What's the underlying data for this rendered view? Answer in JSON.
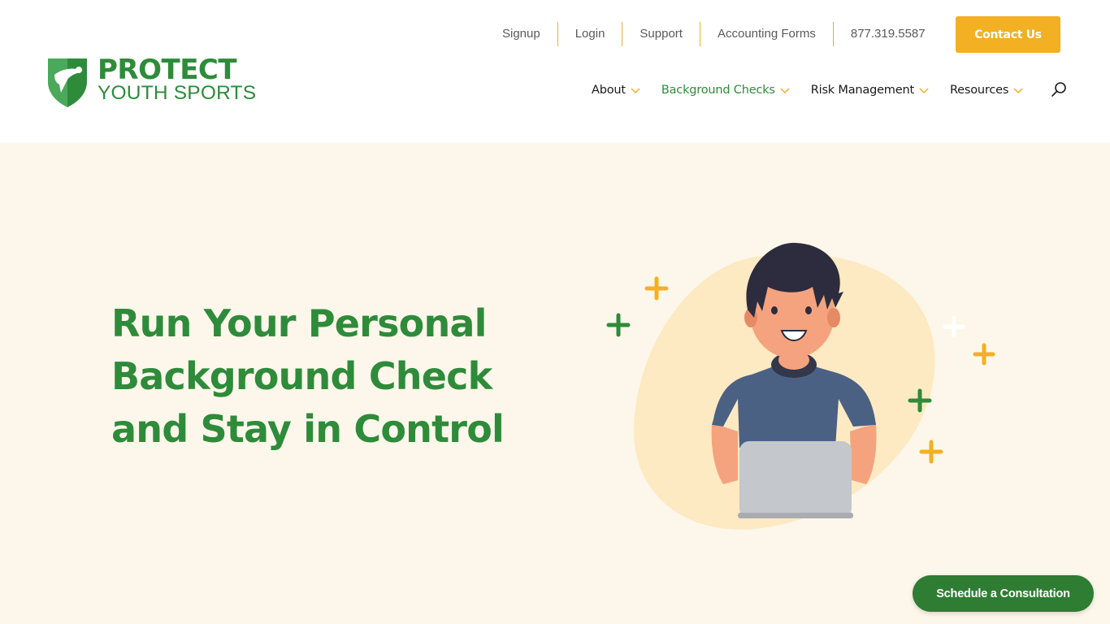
{
  "brand": {
    "name_top": "PROTECT",
    "name_bottom": "YOUTH SPORTS",
    "colors": {
      "green": "#2e8b3a",
      "dark_green": "#2e7d32",
      "gold": "#f2b022",
      "cream": "#fcf7ea"
    }
  },
  "topbar": {
    "links": [
      {
        "label": "Signup"
      },
      {
        "label": "Login"
      },
      {
        "label": "Support"
      },
      {
        "label": "Accounting Forms"
      },
      {
        "label": "877.319.5587"
      }
    ],
    "contact_label": "Contact Us"
  },
  "mainnav": {
    "items": [
      {
        "label": "About",
        "icon": "chevron-down-icon"
      },
      {
        "label": "Background Checks",
        "icon": "chevron-down-icon",
        "active": true
      },
      {
        "label": "Risk Management",
        "icon": "chevron-down-icon"
      },
      {
        "label": "Resources",
        "icon": "chevron-down-icon"
      }
    ],
    "search_icon": "search-icon"
  },
  "hero": {
    "title_lines": [
      "Run Your Personal",
      "Background Check",
      "and Stay in Control"
    ]
  },
  "schedule": {
    "label": "Schedule a Consultation"
  }
}
